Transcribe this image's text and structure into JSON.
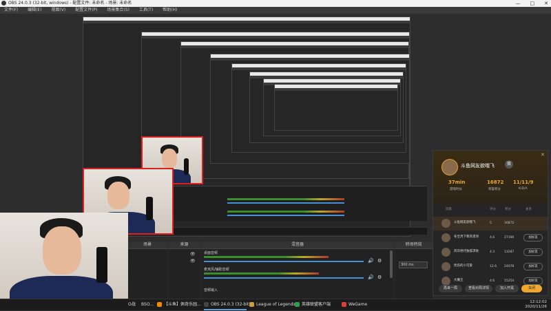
{
  "window": {
    "title": "OBS 24.0.3 (32-bit, windows) - 配置文件: 未命名 - 场景: 未命名",
    "controls": [
      "—",
      "□",
      "✕"
    ]
  },
  "menu": {
    "items": [
      "文件(F)",
      "编辑(E)",
      "视图(V)",
      "配置文件(P)",
      "场景集合(S)",
      "工具(T)",
      "帮助(H)"
    ]
  },
  "panels": {
    "scenes": "场景",
    "sources": "来源",
    "mixer": "混音器",
    "transitions": "转场特效"
  },
  "mixer": {
    "tracks": [
      {
        "name": "桌面音频",
        "level": 0.78
      },
      {
        "name": "麦克风/辅助音频",
        "level": 0.72
      },
      {
        "name": "音频输入"
      }
    ],
    "transition_value": "300 ms"
  },
  "taskbar": {
    "items": [
      {
        "label": "【斗鱼】佩奇乐园...",
        "color": "#f08a00"
      },
      {
        "label": "OBS 24.0.3 (32-bit...",
        "color": "#444"
      },
      {
        "label": "League of Legends",
        "color": "#c8a040"
      },
      {
        "label": "英雄联盟客户端",
        "color": "#2aa04a"
      },
      {
        "label": "WeGame",
        "color": "#e04030"
      }
    ],
    "left_fragments": [
      "O战",
      "BSO..."
    ],
    "time": "12:12:02",
    "date": "2020/11/26"
  },
  "game_card": {
    "player_name": "斗鱼网友欲哦飞",
    "badge": "赛",
    "close": "✕",
    "stats": [
      {
        "value": "37min",
        "label": "游戏时长"
      },
      {
        "value": "16872",
        "label": "荣誉积分"
      },
      {
        "value": "11/11/9",
        "label": "K/D/A"
      }
    ],
    "columns": [
      "玩家",
      "评分",
      "积分",
      "关系"
    ],
    "rows": [
      {
        "name": "斗鱼网友欲哦飞",
        "level": "5",
        "score": "16872",
        "button": "",
        "me": true
      },
      {
        "name": "冬至月下寒风凛冽",
        "level": "4.6",
        "score": "27186",
        "button": "加好友"
      },
      {
        "name": "风华绝代独孤求败",
        "level": "4.3",
        "score": "13287",
        "button": "加好友"
      },
      {
        "name": "忧伤的小可爱",
        "level": "12.6",
        "score": "24078",
        "button": "加好友"
      },
      {
        "name": "大魔王",
        "level": "4.6",
        "score": "15254",
        "button": "加好友"
      }
    ],
    "footer": [
      "再来一局",
      "查看对局详情",
      "加入开黑",
      "关闭"
    ],
    "accent": "#f0a830"
  }
}
